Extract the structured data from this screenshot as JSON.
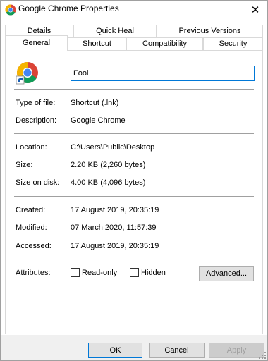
{
  "window": {
    "title": "Google Chrome Properties",
    "close_label": "✕"
  },
  "tabs": {
    "row1": [
      "Details",
      "Quick Heal",
      "Previous Versions"
    ],
    "row2": [
      "General",
      "Shortcut",
      "Compatibility",
      "Security"
    ],
    "active": "General"
  },
  "general": {
    "name_value": "Fool",
    "type_label": "Type of file:",
    "type_value": "Shortcut (.lnk)",
    "description_label": "Description:",
    "description_value": "Google Chrome",
    "location_label": "Location:",
    "location_value": "C:\\Users\\Public\\Desktop",
    "size_label": "Size:",
    "size_value": "2.20 KB (2,260 bytes)",
    "size_on_disk_label": "Size on disk:",
    "size_on_disk_value": "4.00 KB (4,096 bytes)",
    "created_label": "Created:",
    "created_value": "17 August 2019, 20:35:19",
    "modified_label": "Modified:",
    "modified_value": "07 March 2020, 11:57:39",
    "accessed_label": "Accessed:",
    "accessed_value": "17 August 2019, 20:35:19",
    "attributes_label": "Attributes:",
    "readonly_label": "Read-only",
    "hidden_label": "Hidden",
    "advanced_label": "Advanced..."
  },
  "footer": {
    "ok_label": "OK",
    "cancel_label": "Cancel",
    "apply_label": "Apply"
  },
  "icons": {
    "app": "chrome-icon",
    "shortcut_overlay": "shortcut-arrow-icon"
  },
  "colors": {
    "accent": "#0078d7",
    "chrome_red": "#db4437",
    "chrome_yellow": "#f4b400",
    "chrome_green": "#0f9d58",
    "chrome_blue": "#4285f4"
  }
}
